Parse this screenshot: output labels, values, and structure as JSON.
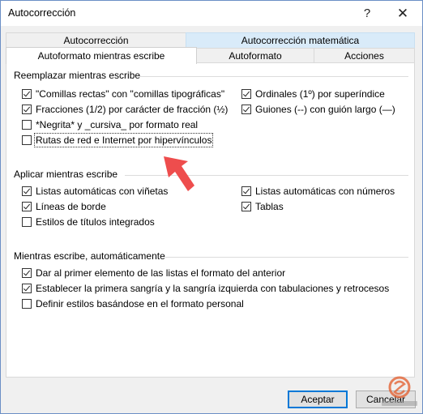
{
  "window": {
    "title": "Autocorrección",
    "help_glyph": "?",
    "close_glyph": "✕"
  },
  "tabs": {
    "back_row": [
      {
        "label": "Autocorrección"
      },
      {
        "label": "Autocorrección matemática"
      }
    ],
    "front_row": [
      {
        "label": "Autoformato mientras escribe",
        "active": true
      },
      {
        "label": "Autoformato"
      },
      {
        "label": "Acciones"
      }
    ]
  },
  "groups": {
    "replace": {
      "title": "Reemplazar mientras escribe",
      "left": [
        {
          "label": "\"Comillas rectas\" con \"comillas tipográficas\"",
          "checked": true
        },
        {
          "label": "Fracciones (1/2) por carácter de fracción (½)",
          "checked": true
        },
        {
          "label": "*Negrita* y _cursiva_ por formato real",
          "checked": false
        },
        {
          "label": "Rutas de red e Internet por hipervínculos",
          "checked": false,
          "focused": true
        }
      ],
      "right": [
        {
          "label": "Ordinales (1º) por superíndice",
          "checked": true
        },
        {
          "label": "Guiones (--) con guión largo (—)",
          "checked": true
        }
      ]
    },
    "apply": {
      "title": "Aplicar mientras escribe",
      "left": [
        {
          "label": "Listas automáticas con viñetas",
          "checked": true
        },
        {
          "label": "Líneas de borde",
          "checked": true
        },
        {
          "label": "Estilos de títulos integrados",
          "checked": false
        }
      ],
      "right": [
        {
          "label": "Listas automáticas con números",
          "checked": true
        },
        {
          "label": "Tablas",
          "checked": true
        }
      ]
    },
    "auto": {
      "title": "Mientras escribe, automáticamente",
      "items": [
        {
          "label": "Dar al primer elemento de las listas el formato del anterior",
          "checked": true
        },
        {
          "label": "Establecer la primera sangría y la sangría izquierda con tabulaciones y retrocesos",
          "checked": true
        },
        {
          "label": "Definir estilos basándose en el formato personal",
          "checked": false
        }
      ]
    }
  },
  "buttons": {
    "ok": "Aceptar",
    "cancel": "Cancelar"
  },
  "annotation": {
    "arrow_color": "#ee4d4d"
  },
  "watermark": {
    "text": "SOLVETIC.COM"
  }
}
